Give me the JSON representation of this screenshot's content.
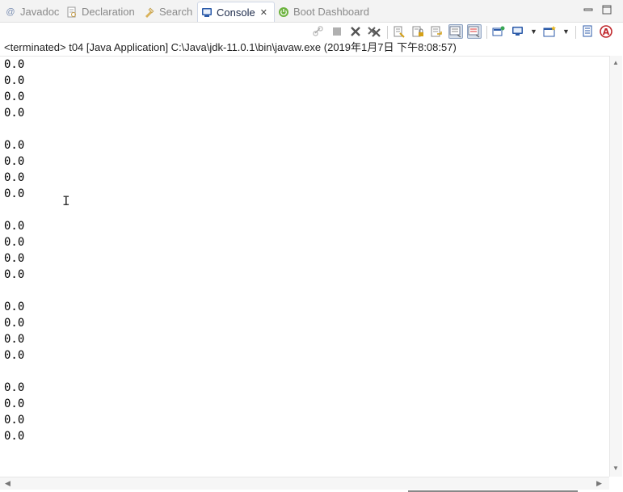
{
  "tabs": [
    {
      "label": "Javadoc",
      "icon": "at-icon",
      "active": false
    },
    {
      "label": "Declaration",
      "icon": "declaration-icon",
      "active": false
    },
    {
      "label": "Search",
      "icon": "flashlight-icon",
      "active": false
    },
    {
      "label": "Console",
      "icon": "console-icon",
      "active": true
    },
    {
      "label": "Boot Dashboard",
      "icon": "power-icon",
      "active": false
    }
  ],
  "window_controls": {
    "minimize": "minimize-icon",
    "maximize": "maximize-icon"
  },
  "toolbar": {
    "buttons": [
      "link-icon",
      "terminate-icon",
      "remove-launch-icon",
      "remove-all-icon",
      "clear-console-icon",
      "scroll-lock-icon",
      "word-wrap-icon",
      "show-on-stdout-icon",
      "show-on-stderr-icon",
      "pin-console-icon",
      "display-console-icon",
      "open-console-icon",
      "copy-icon",
      "spell-icon"
    ]
  },
  "status": "<terminated> t04 [Java Application] C:\\Java\\jdk-11.0.1\\bin\\javaw.exe (2019年1月7日 下午8:08:57)",
  "console": {
    "lines": [
      "0.0",
      "0.0",
      "0.0",
      "0.0",
      "",
      "0.0",
      "0.0",
      "0.0",
      "0.0",
      "",
      "0.0",
      "0.0",
      "0.0",
      "0.0",
      "",
      "0.0",
      "0.0",
      "0.0",
      "0.0",
      "",
      "0.0",
      "0.0",
      "0.0",
      "0.0"
    ]
  }
}
